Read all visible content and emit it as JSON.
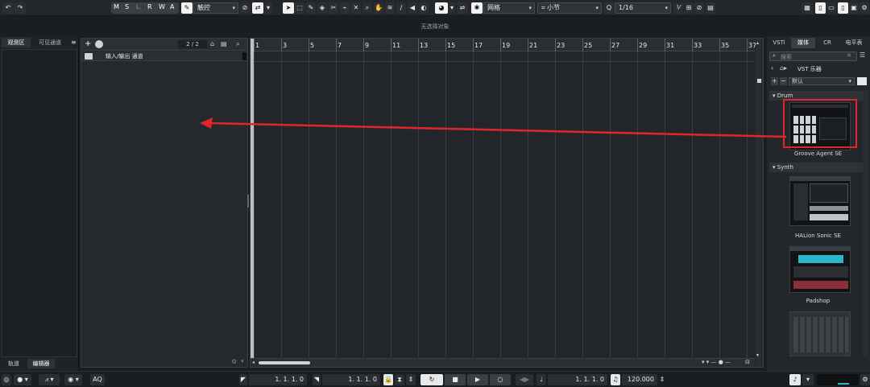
{
  "toolbar": {
    "undo": "↶",
    "redo": "↷",
    "modes": [
      "M",
      "S",
      "L",
      "R",
      "W",
      "A"
    ],
    "automation_mode": "触控",
    "grid_type": "网格",
    "grid_unit": "小节",
    "quantize": "1/16"
  },
  "status_text": "无选择对象",
  "left_zone": {
    "tabs": [
      "观测区",
      "可见通道"
    ],
    "bottom_tabs": [
      "轨道",
      "编辑器"
    ]
  },
  "track_list": {
    "count": "2 / 2",
    "folder_track": "输入/输出 通道"
  },
  "ruler": {
    "bars": [
      "1",
      "3",
      "5",
      "7",
      "9",
      "11",
      "13",
      "15",
      "17",
      "19",
      "21",
      "23",
      "25",
      "27",
      "29",
      "31",
      "33",
      "35",
      "37"
    ]
  },
  "right_zone": {
    "tabs": [
      "VSTi",
      "媒体",
      "CR",
      "电平表"
    ],
    "search_placeholder": "搜索",
    "breadcrumb": "VST 乐器",
    "preset": "默认",
    "sections": [
      {
        "name": "Drum",
        "items": [
          "Groove Agent SE"
        ]
      },
      {
        "name": "Synth",
        "items": [
          "HALion Sonic SE",
          "Padshop"
        ]
      }
    ]
  },
  "transport": {
    "left_locator": "1. 1. 1.   0",
    "right_locator": "1. 1. 1.   0",
    "position": "1. 1. 1.   0",
    "tempo": "120.000",
    "aq_label": "AQ"
  },
  "colors": {
    "accent_selection": "#e0262b",
    "arrow": "#e0262b",
    "background": "#1b1e21"
  }
}
